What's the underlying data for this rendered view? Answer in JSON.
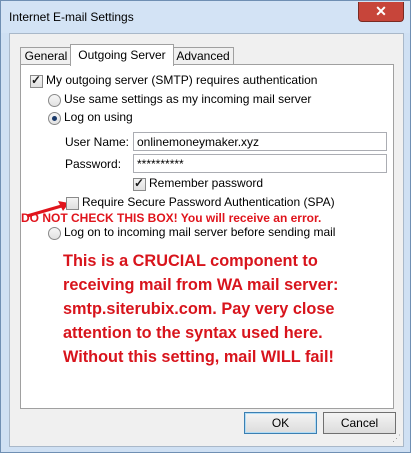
{
  "window": {
    "title": "Internet E-mail Settings",
    "close_glyph": "✕"
  },
  "tabs": [
    {
      "label": "General"
    },
    {
      "label": "Outgoing Server"
    },
    {
      "label": "Advanced"
    }
  ],
  "outgoing": {
    "smtp_auth": {
      "label": "My outgoing server (SMTP) requires authentication",
      "checked": true
    },
    "same_settings": {
      "label": "Use same settings as my incoming mail server",
      "selected": false
    },
    "log_on_using": {
      "label": "Log on using",
      "selected": true
    },
    "user_name": {
      "label": "User Name:",
      "value": "onlinemoneymaker.xyz"
    },
    "password": {
      "label": "Password:",
      "value": "**********"
    },
    "remember_password": {
      "label": "Remember password",
      "checked": true
    },
    "spa": {
      "label": "Require Secure Password Authentication (SPA)",
      "checked": false
    },
    "log_on_incoming": {
      "label": "Log on to incoming mail server before sending mail",
      "selected": false
    }
  },
  "annotations": {
    "warning": "DO NOT CHECK THIS BOX! You will receive an error.",
    "note_lines": [
      "This is a CRUCIAL component to",
      "receiving mail from WA mail server:",
      "smtp.siterubix.com. Pay very close",
      "attention to the syntax used here.",
      "Without this setting, mail WILL fail!"
    ],
    "arrow_color": "#e0141c"
  },
  "buttons": {
    "ok": "OK",
    "cancel": "Cancel"
  },
  "icons": [
    "close-icon",
    "check-icon",
    "radio-dot-icon",
    "arrow-icon",
    "resize-grip-icon"
  ]
}
